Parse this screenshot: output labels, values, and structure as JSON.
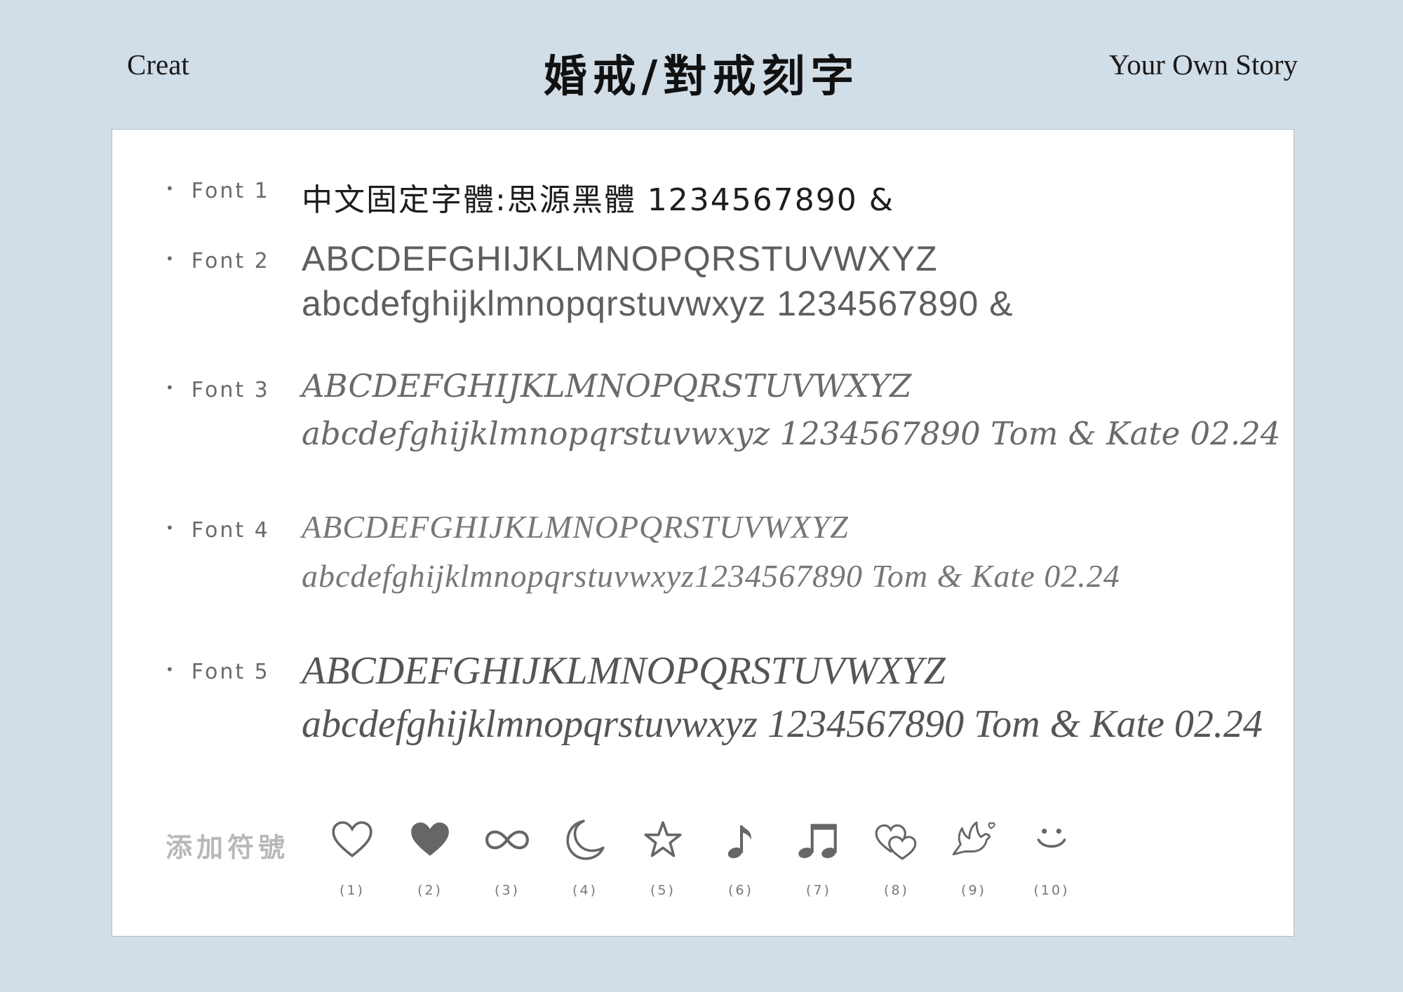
{
  "header": {
    "left": "Creat",
    "title": "婚戒/對戒刻字",
    "right": "Your Own Story"
  },
  "fonts": [
    {
      "label": "Font 1",
      "lines": [
        "中文固定字體:思源黑體  1234567890 &"
      ]
    },
    {
      "label": "Font 2",
      "lines": [
        "ABCDEFGHIJKLMNOPQRSTUVWXYZ",
        "abcdefghijklmnopqrstuvwxyz 1234567890 &"
      ]
    },
    {
      "label": "Font 3",
      "lines": [
        "ABCDEFGHIJKLMNOPQRSTUVWXYZ",
        "abcdefghijklmnopqrstuvwxyz 1234567890   Tom & Kate 02.24"
      ]
    },
    {
      "label": "Font 4",
      "lines": [
        "ABCDEFGHIJKLMNOPQRSTUVWXYZ",
        "abcdefghijklmnopqrstuvwxyz1234567890   Tom & Kate 02.24"
      ]
    },
    {
      "label": "Font 5",
      "lines": [
        "ABCDEFGHIJKLMNOPQRSTUVWXYZ",
        "abcdefghijklmnopqrstuvwxyz 1234567890 Tom & Kate 02.24"
      ]
    }
  ],
  "symbols": {
    "label": "添加符號",
    "items": [
      {
        "icon": "heart-outline-icon",
        "number": "(1)"
      },
      {
        "icon": "heart-filled-icon",
        "number": "(2)"
      },
      {
        "icon": "infinity-icon",
        "number": "(3)"
      },
      {
        "icon": "crescent-moon-icon",
        "number": "(4)"
      },
      {
        "icon": "star-icon",
        "number": "(5)"
      },
      {
        "icon": "eighth-note-icon",
        "number": "(6)"
      },
      {
        "icon": "beamed-notes-icon",
        "number": "(7)"
      },
      {
        "icon": "double-heart-icon",
        "number": "(8)"
      },
      {
        "icon": "dove-icon",
        "number": "(9)"
      },
      {
        "icon": "smiley-icon",
        "number": "(10)"
      }
    ]
  },
  "colors": {
    "background": "#d1dde7",
    "card": "#ffffff",
    "icon": "#666666"
  }
}
